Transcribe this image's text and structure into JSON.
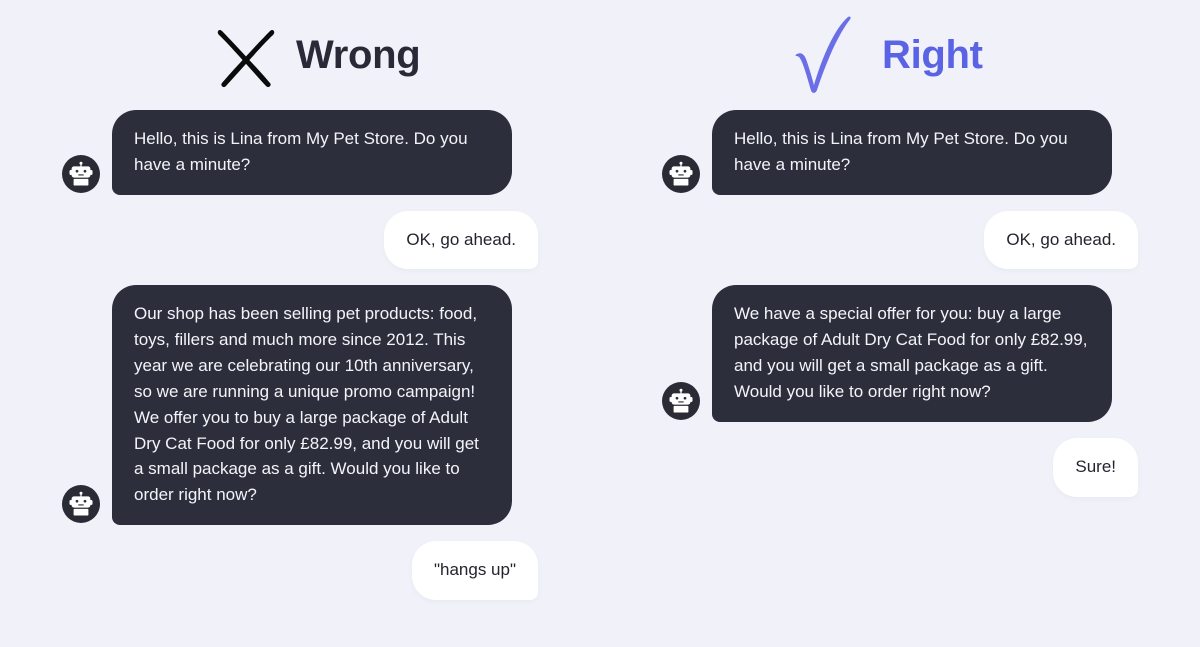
{
  "theme": {
    "background": "#f1f2f9",
    "bot_bubble": "#2c2e3c",
    "user_bubble": "#ffffff",
    "wrong_accent": "#0b0b0e",
    "right_accent": "#5b63e5",
    "title_dark": "#282a38"
  },
  "columns": [
    {
      "id": "wrong",
      "icon": "cross-icon",
      "title": "Wrong",
      "messages": [
        {
          "sender": "bot",
          "avatar": "robot-avatar",
          "text": "Hello, this is Lina from My Pet Store. Do you have a minute?"
        },
        {
          "sender": "user",
          "text": "OK, go ahead."
        },
        {
          "sender": "bot",
          "avatar": "robot-avatar",
          "text": "Our shop has been selling pet products: food, toys, fillers and much more since 2012. This year we are celebrating our 10th anniversary, so we are running a unique promo campaign! We offer you to buy a large package of Adult Dry Cat Food for only £82.99, and you will get a small package as a gift. Would you like to order right now?"
        },
        {
          "sender": "user",
          "text": "\"hangs up\""
        }
      ]
    },
    {
      "id": "right",
      "icon": "check-icon",
      "title": "Right",
      "messages": [
        {
          "sender": "bot",
          "avatar": "robot-avatar",
          "text": "Hello, this is Lina from My Pet Store. Do you have a minute?"
        },
        {
          "sender": "user",
          "text": "OK, go ahead."
        },
        {
          "sender": "bot",
          "avatar": "robot-avatar",
          "text": "We have a special offer for you: buy a large package of Adult Dry Cat Food for only £82.99, and you will get a small package as a gift. Would you like to order right now?"
        },
        {
          "sender": "user",
          "text": "Sure!"
        }
      ]
    }
  ]
}
